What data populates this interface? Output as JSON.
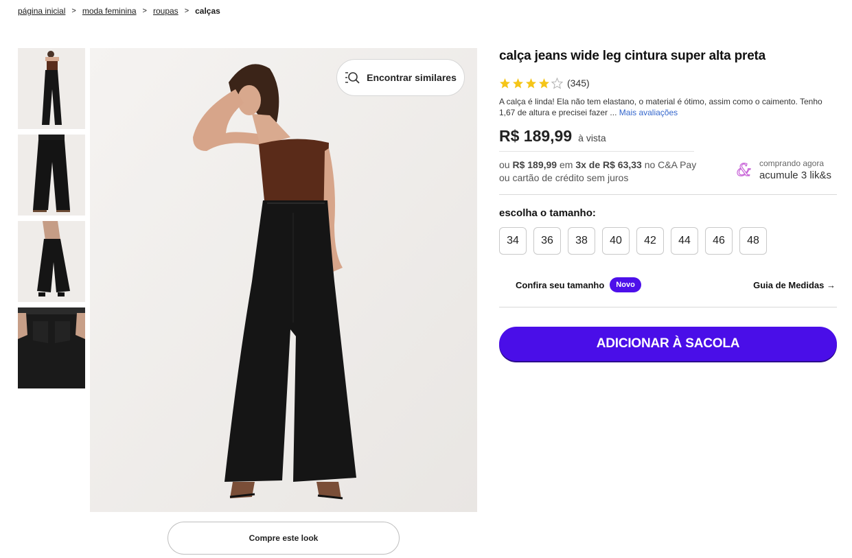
{
  "breadcrumb": {
    "items": [
      "página inicial",
      "moda feminina",
      "roupas"
    ],
    "separator": ">",
    "current": "calças"
  },
  "gallery": {
    "thumbnail_count": 4,
    "find_similar_label": "Encontrar similares",
    "find_similar_icon": "search-list-icon",
    "shop_look_label": "Compre este look"
  },
  "product": {
    "title": "calça jeans wide leg cintura super alta preta",
    "rating": {
      "value": 4,
      "max": 5,
      "count": "(345)",
      "star_color": "#f5c518"
    },
    "review_excerpt": "A calça é linda! Ela não tem elastano, o material é ótimo, assim como o caimento. Tenho 1,67 de altura e precisei fazer ...",
    "more_reviews": "Mais avaliações",
    "price": "R$ 189,99",
    "price_condition": "à vista",
    "installments": {
      "prefix": "ou",
      "total": "R$ 189,99",
      "mid": "em",
      "plan": "3x de R$ 63,33",
      "suffix": "no C&A Pay",
      "line2": "ou cartão de crédito sem juros"
    },
    "likes": {
      "line1": "comprando agora",
      "line2": "acumule 3 lik&s",
      "icon": "ampersand-icon"
    },
    "size_label": "escolha o tamanho:",
    "sizes": [
      "34",
      "36",
      "38",
      "40",
      "42",
      "44",
      "46",
      "48"
    ],
    "fit_check": "Confira seu tamanho",
    "new_badge": "Novo",
    "size_guide": "Guia de Medidas →",
    "add_to_bag": "ADICIONAR À SACOLA"
  },
  "colors": {
    "accent": "#4a0ee8",
    "badge": "#4d10ea",
    "link": "#3366cc"
  }
}
